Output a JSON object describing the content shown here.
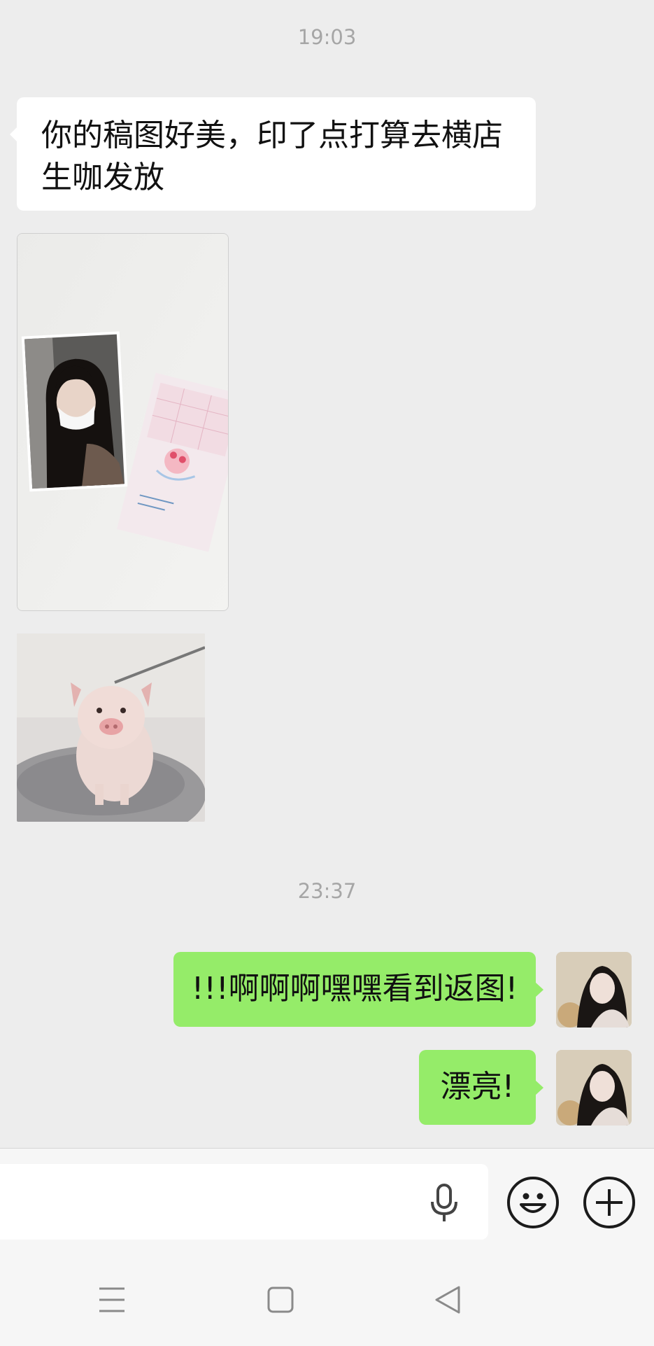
{
  "messages": {
    "time_1": "19:03",
    "incoming_text": "你的稿图好美，印了点打算去横店生咖发放",
    "time_2": "23:37",
    "outgoing_1": "!!!啊啊啊嘿嘿看到返图!",
    "outgoing_2": "漂亮!"
  },
  "icons": {
    "voice": "microphone-icon",
    "emoji": "smiley-icon",
    "more": "plus-circle-icon",
    "nav_menu": "menu-icon",
    "nav_home": "home-square-icon",
    "nav_back": "back-triangle-icon"
  },
  "colors": {
    "background": "#ededed",
    "incoming_bubble": "#ffffff",
    "outgoing_bubble": "#95ec69",
    "timestamp": "#a6a6a6"
  }
}
